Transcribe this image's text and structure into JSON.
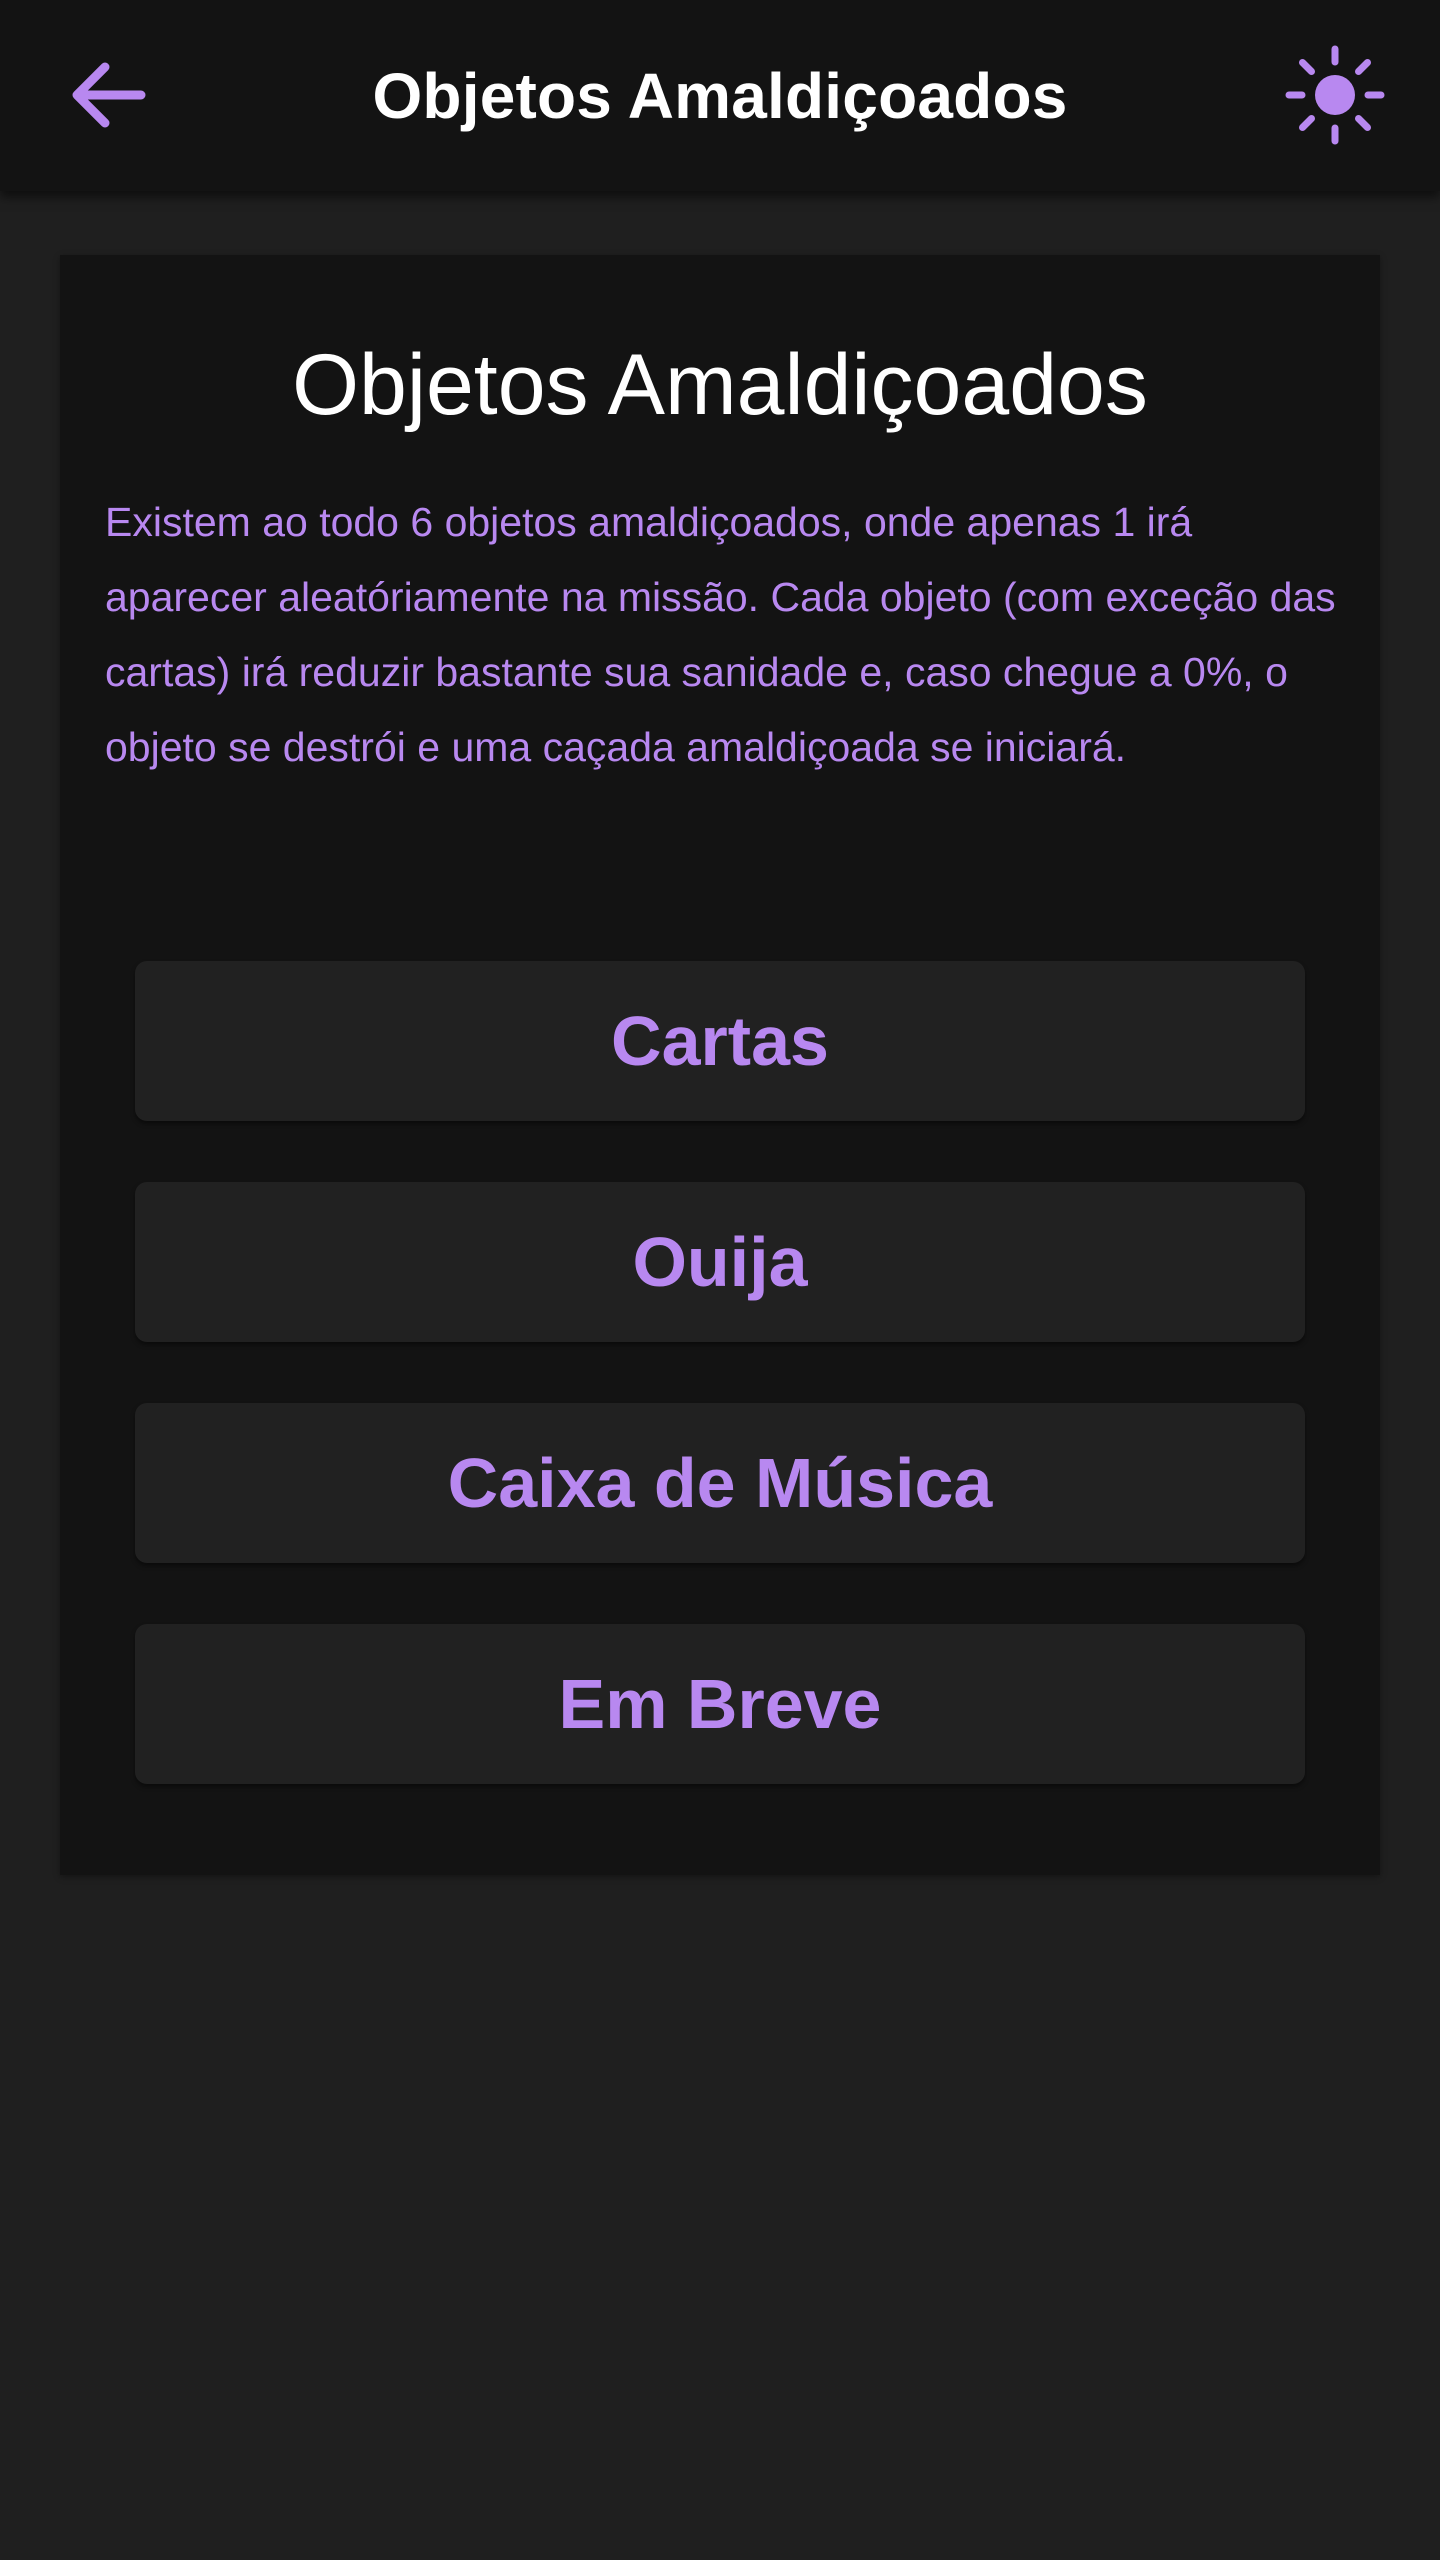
{
  "app_bar": {
    "title": "Objetos Amaldiçoados",
    "back_icon": "arrow-left-icon",
    "theme_icon": "sun-icon"
  },
  "card": {
    "heading": "Objetos Amaldiçoados",
    "description": "Existem ao todo 6 objetos amaldiçoados, onde apenas 1 irá aparecer aleatóriamente na missão. Cada objeto (com exceção das cartas) irá reduzir bastante sua sanidade e, caso chegue a 0%, o objeto se destrói e uma caçada amaldiçoada se iniciará."
  },
  "menu": {
    "items": [
      {
        "label": "Cartas"
      },
      {
        "label": "Ouija"
      },
      {
        "label": "Caixa de Música"
      },
      {
        "label": "Em Breve"
      }
    ]
  },
  "colors": {
    "accent": "#b888f0",
    "background": "#1f1f1f",
    "surface": "#131313",
    "button": "#212121",
    "text": "#ffffff"
  }
}
